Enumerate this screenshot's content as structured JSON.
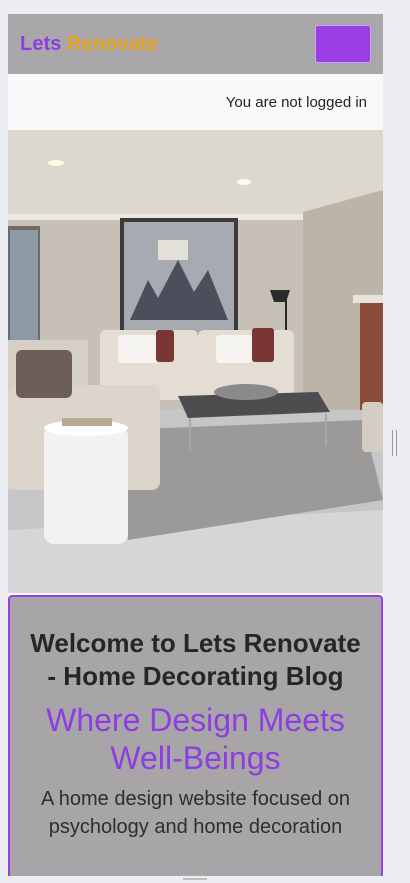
{
  "navbar": {
    "brand_part1": "Lets",
    "brand_part2": "Renovate",
    "toggler_icon": "hamburger-menu-icon",
    "colors": {
      "bar": "#a9a7aa",
      "brand_purple": "#8e3de0",
      "brand_gold": "#e8a317",
      "toggler": "#9b3ee6"
    }
  },
  "status": {
    "login_text": "You are not logged in"
  },
  "hero": {
    "image": "living-room-photo"
  },
  "card": {
    "title": "Welcome to Lets Renovate - Home Decorating Blog",
    "subtitle": "Where Design Meets Well-Beings",
    "description": "A home design website focused on psychology and home decoration",
    "colors": {
      "border": "#9b3ee6",
      "background": "#a7a5a8"
    }
  }
}
